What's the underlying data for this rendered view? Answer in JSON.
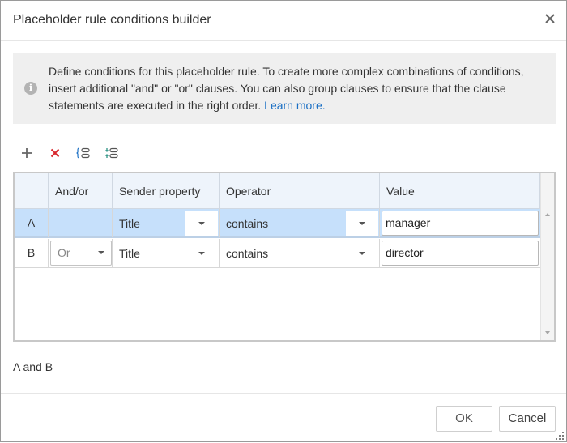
{
  "dialog": {
    "title": "Placeholder rule conditions builder"
  },
  "info": {
    "text": "Define conditions for this placeholder rule. To create more complex combinations of conditions, insert additional \"and\" or \"or\" clauses. You can also group clauses to ensure that the clause statements are executed in the right order.",
    "link_label": "Learn more."
  },
  "toolbar": {
    "icons": [
      "add-icon",
      "delete-icon",
      "group-icon",
      "ungroup-icon"
    ],
    "colors": {
      "add": "#666666",
      "delete": "#d9262c",
      "group": "#1a6fc4"
    }
  },
  "grid": {
    "columns": [
      "",
      "And/or",
      "Sender property",
      "Operator",
      "Value"
    ],
    "rows": [
      {
        "letter": "A",
        "andor": "",
        "property": "Title",
        "operator": "contains",
        "value": "manager",
        "selected": true
      },
      {
        "letter": "B",
        "andor": "Or",
        "property": "Title",
        "operator": "contains",
        "value": "director",
        "selected": false
      }
    ],
    "colors": {
      "header_bg": "#eef4fb",
      "selected_bg": "#c6e0fb"
    }
  },
  "expression": "A and B",
  "footer": {
    "ok_label": "OK",
    "cancel_label": "Cancel"
  }
}
